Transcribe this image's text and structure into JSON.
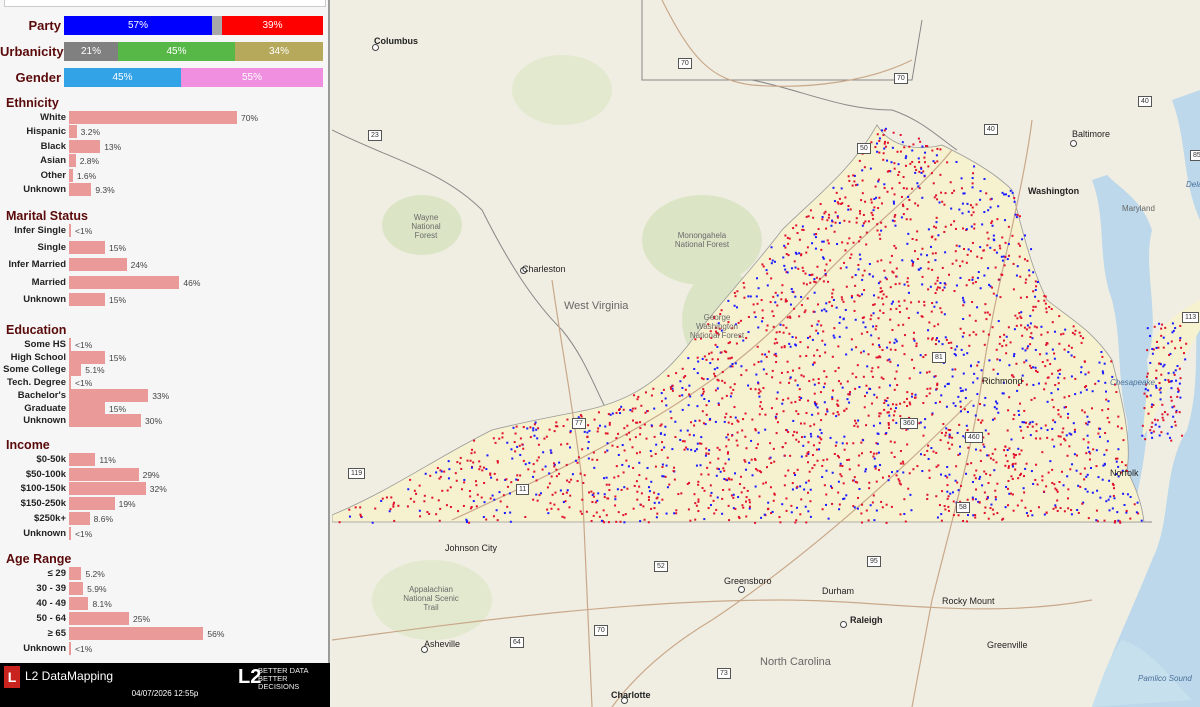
{
  "summary": {
    "party": {
      "label": "Party",
      "segments": [
        {
          "value": "57%",
          "pct": 57,
          "color": "#0000ff"
        },
        {
          "value": "",
          "pct": 4,
          "color": "#a8a8a8"
        },
        {
          "value": "39%",
          "pct": 39,
          "color": "#ff0000"
        }
      ]
    },
    "urbanicity": {
      "label": "Urbanicity",
      "segments": [
        {
          "value": "21%",
          "pct": 21,
          "color": "#808080"
        },
        {
          "value": "45%",
          "pct": 45,
          "color": "#57b848"
        },
        {
          "value": "34%",
          "pct": 34,
          "color": "#b7a95c"
        }
      ]
    },
    "gender": {
      "label": "Gender",
      "segments": [
        {
          "value": "45%",
          "pct": 45,
          "color": "#33a3e8"
        },
        {
          "value": "55%",
          "pct": 55,
          "color": "#f08ee0"
        }
      ]
    }
  },
  "sections": [
    {
      "title": "Ethnicity",
      "rows": [
        {
          "label": "White",
          "value": "70%",
          "pct": 70
        },
        {
          "label": "Hispanic",
          "value": "3.2%",
          "pct": 3.2
        },
        {
          "label": "Black",
          "value": "13%",
          "pct": 13
        },
        {
          "label": "Asian",
          "value": "2.8%",
          "pct": 2.8
        },
        {
          "label": "Other",
          "value": "1.6%",
          "pct": 1.6
        },
        {
          "label": "Unknown",
          "value": "9.3%",
          "pct": 9.3
        }
      ]
    },
    {
      "title": "Marital Status",
      "rows": [
        {
          "label": "Infer Single",
          "value": "<1%",
          "pct": 0.8
        },
        {
          "label": "Single",
          "value": "15%",
          "pct": 15
        },
        {
          "label": "Infer Married",
          "value": "24%",
          "pct": 24
        },
        {
          "label": "Married",
          "value": "46%",
          "pct": 46
        },
        {
          "label": "Unknown",
          "value": "15%",
          "pct": 15
        }
      ]
    },
    {
      "title": "Education",
      "rows": [
        {
          "label": "Some HS",
          "value": "<1%",
          "pct": 0.8
        },
        {
          "label": "High School",
          "value": "15%",
          "pct": 15
        },
        {
          "label": "Some College",
          "value": "5.1%",
          "pct": 5.1
        },
        {
          "label": "Tech. Degree",
          "value": "<1%",
          "pct": 0.5
        },
        {
          "label": "Bachelor's",
          "value": "33%",
          "pct": 33
        },
        {
          "label": "Graduate",
          "value": "15%",
          "pct": 15
        },
        {
          "label": "Unknown",
          "value": "30%",
          "pct": 30
        }
      ]
    },
    {
      "title": "Income",
      "rows": [
        {
          "label": "$0-50k",
          "value": "11%",
          "pct": 11
        },
        {
          "label": "$50-100k",
          "value": "29%",
          "pct": 29
        },
        {
          "label": "$100-150k",
          "value": "32%",
          "pct": 32
        },
        {
          "label": "$150-250k",
          "value": "19%",
          "pct": 19
        },
        {
          "label": "$250k+",
          "value": "8.6%",
          "pct": 8.6
        },
        {
          "label": "Unknown",
          "value": "<1%",
          "pct": 0.5
        }
      ]
    },
    {
      "title": "Age Range",
      "rows": [
        {
          "label": "≤ 29",
          "value": "5.2%",
          "pct": 5.2
        },
        {
          "label": "30 - 39",
          "value": "5.9%",
          "pct": 5.9
        },
        {
          "label": "40 - 49",
          "value": "8.1%",
          "pct": 8.1
        },
        {
          "label": "50 - 64",
          "value": "25%",
          "pct": 25
        },
        {
          "label": "≥ 65",
          "value": "56%",
          "pct": 56
        },
        {
          "label": "Unknown",
          "value": "<1%",
          "pct": 0.5
        }
      ]
    }
  ],
  "footer": {
    "logo": "L",
    "brand": "L2 DataMapping",
    "l2": "L2",
    "tagline_1": "BETTER DATA",
    "tagline_2": "BETTER DECISIONS",
    "timestamp": "04/07/2026 12:55p"
  },
  "map": {
    "colors": {
      "democrat": "#1a1aff",
      "republican": "#e0112b",
      "background": "#f0eee2",
      "water": "#bcd8ea",
      "forest": "#d9e3c4",
      "virginia_fill": "#f6f1cf"
    },
    "cities": [
      "Columbus",
      "Charleston",
      "Baltimore",
      "Washington",
      "Richmond",
      "Norfolk",
      "Johnson City",
      "Greensboro",
      "Durham",
      "Raleigh",
      "Rocky Mount",
      "Greenville",
      "Asheville",
      "Charlotte"
    ],
    "states": [
      "West Virginia",
      "North Carolina",
      "Maryland"
    ],
    "areas": [
      "Wayne National Forest",
      "Monongahela National Forest",
      "George Washington National Forest",
      "Appalachian National Scenic Trail"
    ],
    "water": [
      "Chesapeake",
      "Pamlico Sound",
      "Delaware"
    ],
    "routes": [
      "70",
      "70",
      "40",
      "50",
      "23",
      "77",
      "119",
      "11",
      "52",
      "40",
      "85",
      "64",
      "70",
      "73",
      "95",
      "113",
      "58",
      "460",
      "360",
      "81"
    ]
  }
}
